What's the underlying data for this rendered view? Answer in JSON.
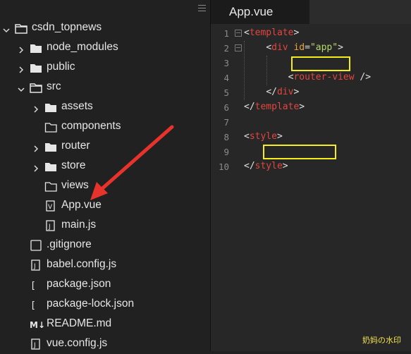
{
  "explorer": {
    "items": [
      {
        "label": "csdn_topnews",
        "icon": "folder-open-icon",
        "expand": "expanded"
      },
      {
        "label": "node_modules",
        "icon": "folder-icon",
        "expand": "collapsed"
      },
      {
        "label": "public",
        "icon": "folder-icon",
        "expand": "collapsed"
      },
      {
        "label": "src",
        "icon": "folder-open-icon",
        "expand": "expanded"
      },
      {
        "label": "assets",
        "icon": "folder-icon",
        "expand": "collapsed"
      },
      {
        "label": "components",
        "icon": "folder-outline-icon",
        "expand": "none"
      },
      {
        "label": "router",
        "icon": "folder-icon",
        "expand": "collapsed"
      },
      {
        "label": "store",
        "icon": "folder-icon",
        "expand": "collapsed"
      },
      {
        "label": "views",
        "icon": "folder-outline-icon",
        "expand": "none"
      },
      {
        "label": "App.vue",
        "icon": "vue-file-icon",
        "expand": "none"
      },
      {
        "label": "main.js",
        "icon": "js-file-icon",
        "expand": "none"
      },
      {
        "label": ".gitignore",
        "icon": "file-icon",
        "expand": "none"
      },
      {
        "label": "babel.config.js",
        "icon": "js-file-icon",
        "expand": "none"
      },
      {
        "label": "package.json",
        "icon": "json-file-icon",
        "expand": "none"
      },
      {
        "label": "package-lock.json",
        "icon": "json-file-icon",
        "expand": "none"
      },
      {
        "label": "README.md",
        "icon": "markdown-file-icon",
        "expand": "none"
      },
      {
        "label": "vue.config.js",
        "icon": "js-file-icon",
        "expand": "none"
      }
    ]
  },
  "editor": {
    "tab": {
      "label": "App.vue"
    },
    "line_numbers": [
      "1",
      "2",
      "3",
      "4",
      "5",
      "6",
      "7",
      "8",
      "9",
      "10"
    ],
    "lines": {
      "l1": {
        "lt": "<",
        "tag": "template",
        "gt": ">"
      },
      "l2": {
        "lt": "<",
        "tag": "div",
        "attr": "id",
        "eq": "=",
        "str": "\"app\"",
        "gt": ">"
      },
      "l4": {
        "lt": "<",
        "tag": "router-view",
        "close": " />"
      },
      "l5": {
        "lt": "</",
        "tag": "div",
        "gt": ">"
      },
      "l6": {
        "lt": "</",
        "tag": "template",
        "gt": ">"
      },
      "l8": {
        "lt": "<",
        "tag": "style",
        "gt": ">"
      },
      "l10": {
        "lt": "</",
        "tag": "style",
        "gt": ">"
      }
    }
  },
  "watermark": "奶妈の水印",
  "colors": {
    "tag": "#e2463f",
    "attr": "#f0a13c",
    "string": "#b5d86a",
    "highlight": "#f5ee1c",
    "arrow": "#e8322c"
  }
}
